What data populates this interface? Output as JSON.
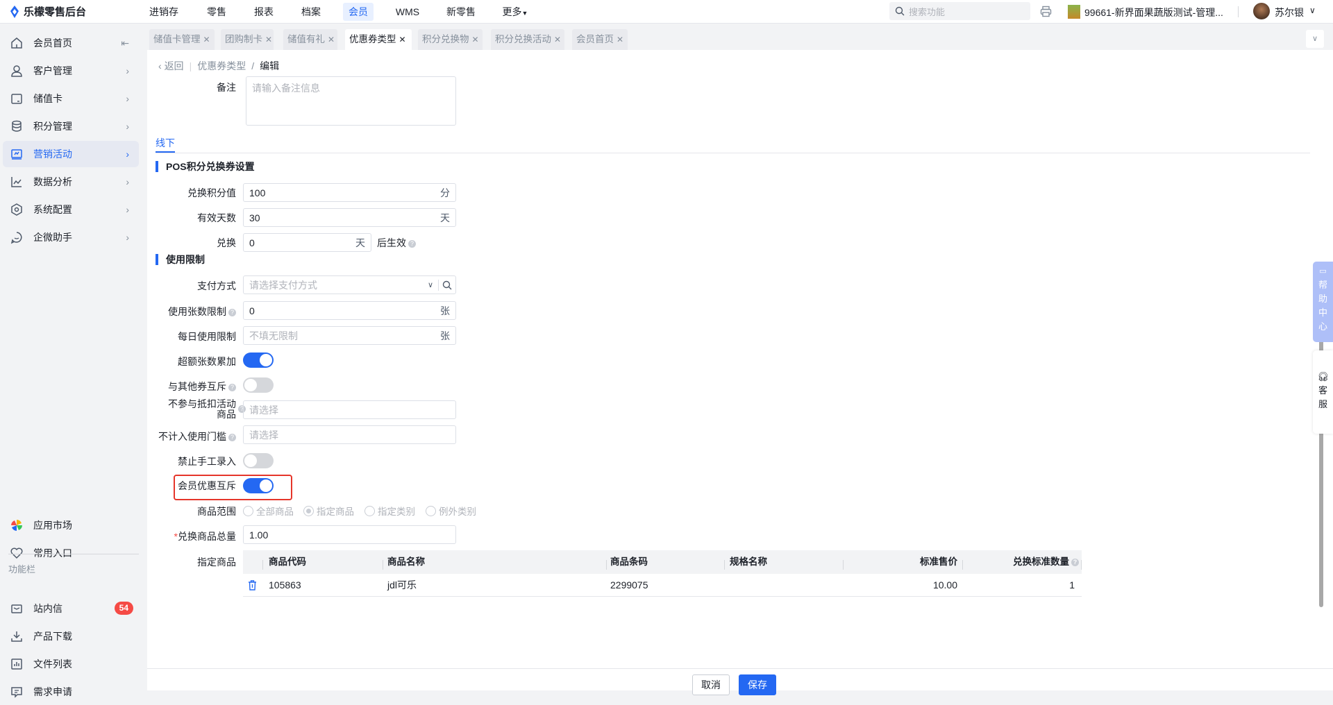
{
  "app": {
    "title": "乐檬零售后台"
  },
  "topnav": {
    "items": [
      "进销存",
      "零售",
      "报表",
      "档案",
      "会员",
      "WMS",
      "新零售",
      "更多"
    ],
    "active": "会员"
  },
  "header": {
    "search_placeholder": "搜索功能",
    "store": "99661-新界面果蔬版测试-管理...",
    "user": "苏尔银"
  },
  "tabs": [
    {
      "label": "储值卡管理"
    },
    {
      "label": "团购制卡"
    },
    {
      "label": "储值有礼"
    },
    {
      "label": "优惠券类型",
      "active": true
    },
    {
      "label": "积分兑换物"
    },
    {
      "label": "积分兑换活动"
    },
    {
      "label": "会员首页"
    }
  ],
  "sidebar": {
    "items": [
      "会员首页",
      "客户管理",
      "储值卡",
      "积分管理",
      "营销活动",
      "数据分析",
      "系统配置",
      "企微助手"
    ],
    "active": "营销活动",
    "bottom": [
      "应用市场",
      "常用入口"
    ],
    "section": "功能栏",
    "tools": [
      "站内信",
      "产品下载",
      "文件列表",
      "需求申请"
    ],
    "badge": "54"
  },
  "breadcrumb": {
    "back": "返回",
    "parent": "优惠券类型",
    "current": "编辑"
  },
  "form": {
    "remark_label": "备注",
    "remark_placeholder": "请输入备注信息",
    "tab": "线下",
    "section1": "POS积分兑换券设置",
    "points_label": "兑换积分值",
    "points_value": "100",
    "points_unit": "分",
    "days_label": "有效天数",
    "days_value": "30",
    "days_unit": "天",
    "delay_label": "兑换",
    "delay_value": "0",
    "delay_unit": "天",
    "delay_suffix": "后生效",
    "section2": "使用限制",
    "pay_label": "支付方式",
    "pay_placeholder": "请选择支付方式",
    "count_label": "使用张数限制",
    "count_value": "0",
    "count_unit": "张",
    "daily_label": "每日使用限制",
    "daily_placeholder": "不填无限制",
    "daily_unit": "张",
    "overflow_label": "超额张数累加",
    "overflow_on": true,
    "mutex_label": "与其他券互斥",
    "mutex_on": false,
    "exclude_label_1": "不参与抵扣活动",
    "exclude_label_2": "商品",
    "exclude_placeholder": "请选择",
    "threshold_label": "不计入使用门槛",
    "threshold_placeholder": "请选择",
    "manual_label": "禁止手工录入",
    "manual_on": false,
    "member_mutex_label": "会员优惠互斥",
    "member_mutex_on": true,
    "scope_label": "商品范围",
    "scope_options": [
      "全部商品",
      "指定商品",
      "指定类别",
      "例外类别"
    ],
    "scope_selected": "指定商品",
    "total_label": "兑换商品总量",
    "total_value": "1.00",
    "goods_label": "指定商品"
  },
  "table": {
    "columns": [
      "商品代码",
      "商品名称",
      "商品条码",
      "规格名称",
      "标准售价",
      "兑换标准数量"
    ],
    "rows": [
      {
        "code": "105863",
        "name": "jdl可乐",
        "barcode": "2299075",
        "spec": "",
        "price": "10.00",
        "qty": "1"
      }
    ]
  },
  "footer": {
    "cancel": "取消",
    "save": "保存"
  },
  "float": {
    "help": [
      "帮",
      "助",
      "中",
      "心"
    ],
    "service": [
      "客",
      "服"
    ]
  },
  "colors": {
    "primary": "#2468f2",
    "badge": "#f54a45",
    "highlight_box": "#e5352a"
  }
}
